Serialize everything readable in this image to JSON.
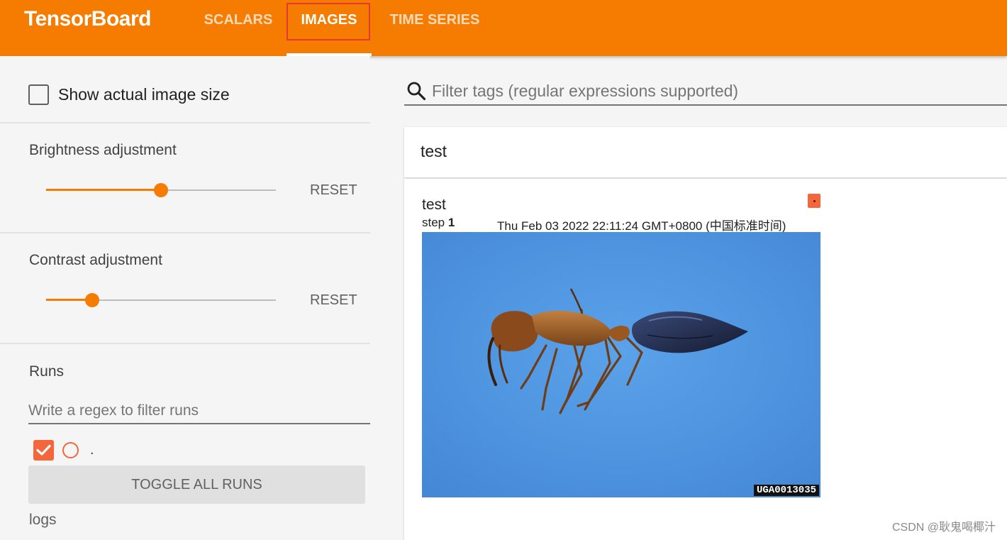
{
  "app": {
    "brand": "TensorBoard",
    "tabs": [
      {
        "label": "SCALARS",
        "active": false
      },
      {
        "label": "IMAGES",
        "active": true
      },
      {
        "label": "TIME SERIES",
        "active": false
      }
    ],
    "accent_color": "#f57c00",
    "highlight_color": "#e53935"
  },
  "sidebar": {
    "actual_size_label": "Show actual image size",
    "actual_size_checked": false,
    "brightness": {
      "label": "Brightness adjustment",
      "reset_label": "RESET",
      "value_fraction": 0.5
    },
    "contrast": {
      "label": "Contrast adjustment",
      "reset_label": "RESET",
      "value_fraction": 0.2
    },
    "runs": {
      "title": "Runs",
      "filter_placeholder": "Write a regex to filter runs",
      "items": [
        {
          "name": ".",
          "checked": true,
          "color": "#f4663b"
        }
      ],
      "toggle_label": "TOGGLE ALL RUNS",
      "logdir": "logs"
    }
  },
  "main": {
    "search_placeholder": "Filter tags (regular expressions supported)",
    "group_title": "test",
    "card": {
      "tag": "test",
      "step_label": "step",
      "step_value": "1",
      "timestamp": "Thu Feb 03 2022 22:11:24 GMT+0800 (中国标准时间)",
      "image_id": "UGA0013035",
      "image_description_icon": "ant-specimen-image"
    }
  },
  "watermark": "CSDN @耿鬼喝椰汁"
}
